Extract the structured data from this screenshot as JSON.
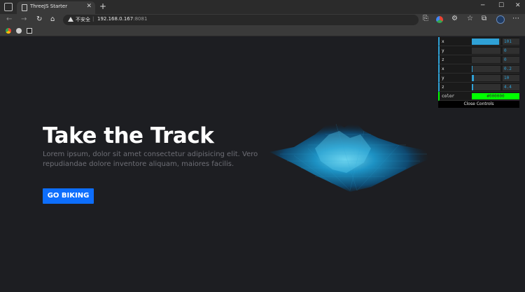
{
  "browser": {
    "tab_title": "ThreeJS Starter",
    "tab_close": "✕",
    "new_tab": "+",
    "window_controls": [
      "─",
      "☐",
      "✕"
    ],
    "security_label": "不安全",
    "url_separator": "|",
    "url_host": "192.168.0.167",
    "url_port": ":8081",
    "nav_icons": [
      "back-arrow-icon",
      "forward-arrow-icon",
      "reload-icon",
      "home-icon"
    ],
    "bookmark_icons": [
      "chrome-icon",
      "github-icon",
      "app-icon"
    ]
  },
  "hero": {
    "title": "Take the Track",
    "text": "Lorem ipsum, dolor sit amet consectetur adipisicing elit. Vero repudiandae dolore inventore aliquam, maiores facilis.",
    "button": "GO BIKING"
  },
  "gui": {
    "rows": [
      {
        "label": "x",
        "value": "101",
        "fill": 0.95
      },
      {
        "label": "y",
        "value": "0",
        "fill": 0.0
      },
      {
        "label": "z",
        "value": "0",
        "fill": 0.0
      },
      {
        "label": "x",
        "value": "0.2",
        "fill": 0.03
      },
      {
        "label": "y",
        "value": "10",
        "fill": 0.08
      },
      {
        "label": "z",
        "value": "4.4",
        "fill": 0.04
      }
    ],
    "color_label": "color",
    "color_value": "#000000",
    "color_swatch": "#00ff00",
    "close_label": "Close Controls"
  },
  "colors": {
    "accent": "#2fa1d6",
    "button": "#0d6efd",
    "background": "#1d1e22"
  }
}
